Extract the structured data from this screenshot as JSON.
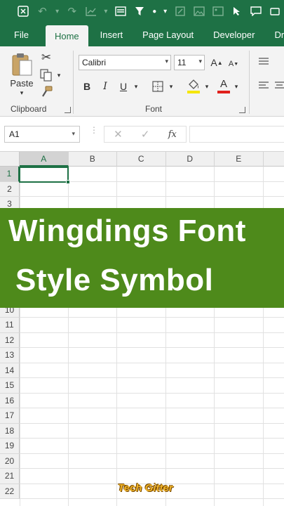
{
  "qat": {
    "icons": [
      "excel-save-icon",
      "undo-icon",
      "redo-icon",
      "chart-icon",
      "form-icon",
      "filter-icon",
      "bullet-icon",
      "dropdown-icon",
      "format-icon",
      "image-icon",
      "picture-icon",
      "select-icon",
      "comment-icon",
      "camera-icon"
    ]
  },
  "tabs": [
    "File",
    "Home",
    "Insert",
    "Page Layout",
    "Developer",
    "Dra"
  ],
  "active_tab": "Home",
  "ribbon": {
    "clipboard": {
      "paste_label": "Paste",
      "group_label": "Clipboard"
    },
    "font": {
      "font_name": "Calibri",
      "font_size": "11",
      "bold": "B",
      "italic": "I",
      "underline": "U",
      "grow": "A",
      "shrink": "A",
      "font_color": "A",
      "group_label": "Font"
    }
  },
  "formula_bar": {
    "name_box": "A1",
    "fx": "fx",
    "cancel": "✕",
    "enter": "✓"
  },
  "grid": {
    "columns": [
      "A",
      "B",
      "C",
      "D",
      "E"
    ],
    "rows_top": [
      "1",
      "2",
      "3"
    ],
    "rows_bottom": [
      "10",
      "11",
      "12",
      "13",
      "14",
      "15",
      "16",
      "17",
      "18",
      "19",
      "20",
      "21",
      "22"
    ],
    "selected_cell": "A1"
  },
  "banner": {
    "line1": "Wingdings Font",
    "line2": "Style Symbol",
    "color": "#4e8a1b"
  },
  "watermark": "Tech Gitter",
  "colors": {
    "excel_green": "#1e7145",
    "ribbon_bg": "#f3f3f3",
    "font_color_red": "#e0201c"
  }
}
